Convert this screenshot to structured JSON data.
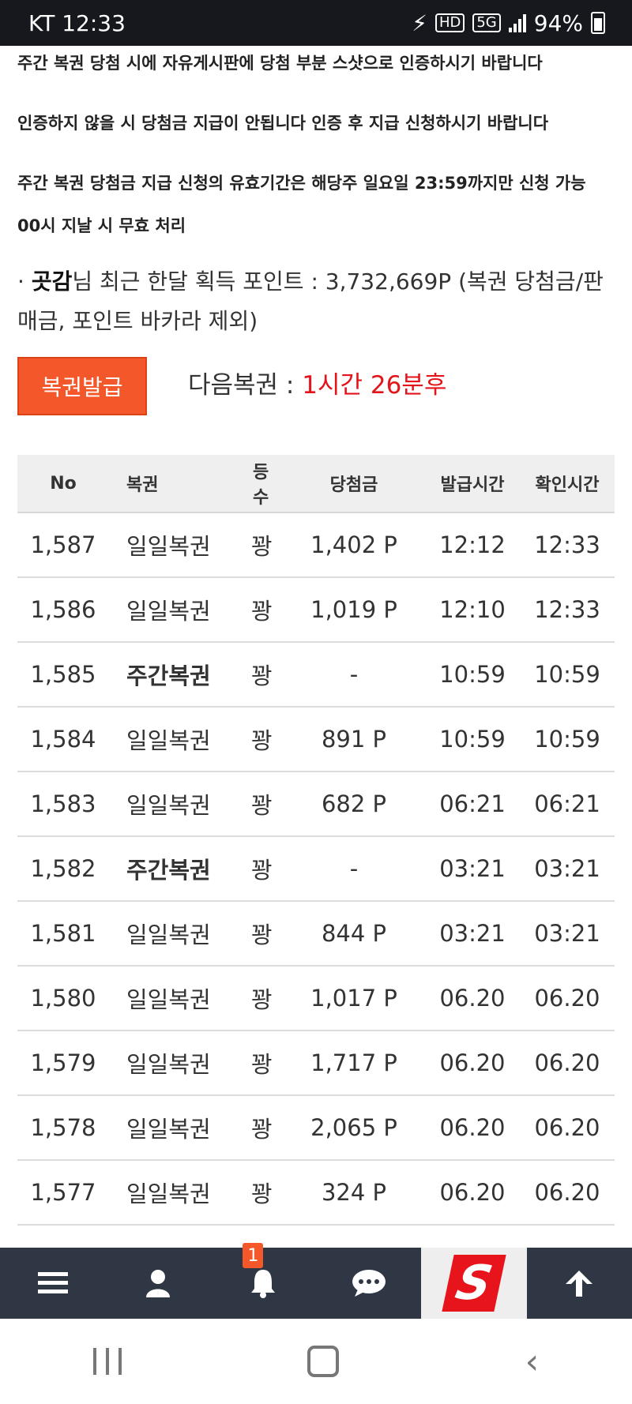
{
  "status_bar": {
    "carrier_time": "KT 12:33",
    "network": "5G",
    "battery": "94%"
  },
  "notices": [
    "주간 복권 당첨 시에 자유게시판에 당첨 부분 스샷으로 인증하시기 바랍니다",
    "인증하지 않을 시 당첨금 지급이 안됩니다 인증 후 지급 신청하시기 바랍니다",
    "주간 복권 당첨금 지급 신청의 유효기간은 해당주 일요일 23:59까지만 신청 가능",
    "00시 지날 시 무효 처리"
  ],
  "points": {
    "bullet": "·",
    "user": "곳감",
    "text": "님 최근 한달 획득 포인트 : 3,732,669P (복권 당첨금/판매금, 포인트 바카라 제외)"
  },
  "issue_button": "복권발급",
  "next_lottery": {
    "label": "다음복권 : ",
    "time": "1시간 26분후"
  },
  "table": {
    "headers": [
      "No",
      "복권",
      "등수",
      "당첨금",
      "발급시간",
      "확인시간"
    ],
    "rows": [
      {
        "no": "1,587",
        "type": "일일복권",
        "rank": "꽝",
        "prize": "1,402 P",
        "issued": "12:12",
        "checked": "12:33"
      },
      {
        "no": "1,586",
        "type": "일일복권",
        "rank": "꽝",
        "prize": "1,019 P",
        "issued": "12:10",
        "checked": "12:33"
      },
      {
        "no": "1,585",
        "type": "주간복권",
        "rank": "꽝",
        "prize": "-",
        "issued": "10:59",
        "checked": "10:59"
      },
      {
        "no": "1,584",
        "type": "일일복권",
        "rank": "꽝",
        "prize": "891 P",
        "issued": "10:59",
        "checked": "10:59"
      },
      {
        "no": "1,583",
        "type": "일일복권",
        "rank": "꽝",
        "prize": "682 P",
        "issued": "06:21",
        "checked": "06:21"
      },
      {
        "no": "1,582",
        "type": "주간복권",
        "rank": "꽝",
        "prize": "-",
        "issued": "03:21",
        "checked": "03:21"
      },
      {
        "no": "1,581",
        "type": "일일복권",
        "rank": "꽝",
        "prize": "844 P",
        "issued": "03:21",
        "checked": "03:21"
      },
      {
        "no": "1,580",
        "type": "일일복권",
        "rank": "꽝",
        "prize": "1,017 P",
        "issued": "06.20",
        "checked": "06.20"
      },
      {
        "no": "1,579",
        "type": "일일복권",
        "rank": "꽝",
        "prize": "1,717 P",
        "issued": "06.20",
        "checked": "06.20"
      },
      {
        "no": "1,578",
        "type": "일일복권",
        "rank": "꽝",
        "prize": "2,065 P",
        "issued": "06.20",
        "checked": "06.20"
      },
      {
        "no": "1,577",
        "type": "일일복권",
        "rank": "꽝",
        "prize": "324 P",
        "issued": "06.20",
        "checked": "06.20"
      }
    ]
  },
  "bottom_nav": {
    "notification_count": "1",
    "logo_letter": "S"
  },
  "colors": {
    "accent": "#f4572a",
    "next_time": "#e3141a",
    "nav_bg": "#2f3744"
  }
}
